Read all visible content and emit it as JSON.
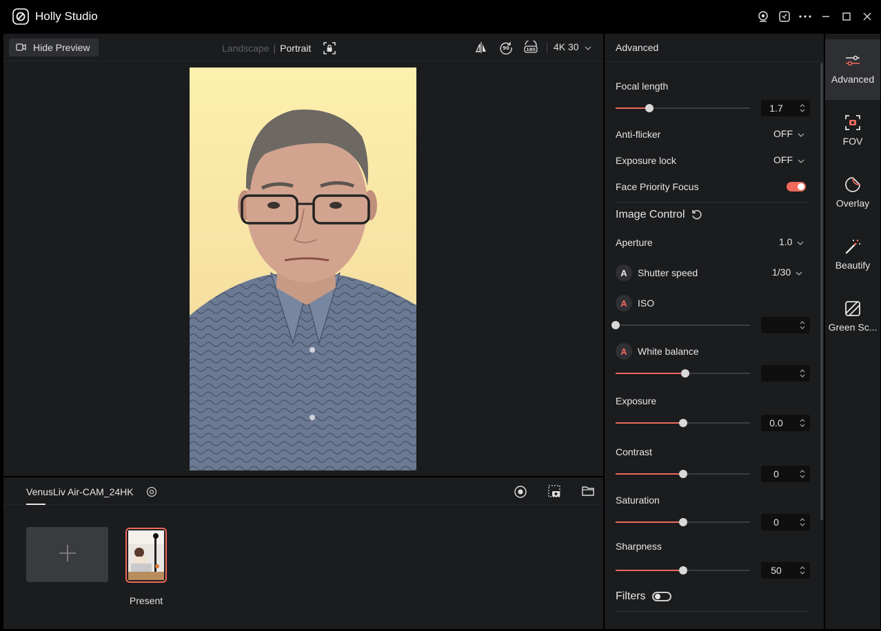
{
  "app": {
    "title": "Holly Studio"
  },
  "preview_toolbar": {
    "hide_preview_label": "Hide Preview",
    "orientation_landscape": "Landscape",
    "orientation_portrait": "Portrait",
    "orientation_selected": "Portrait",
    "resolution": "4K 30"
  },
  "camera": {
    "device_name": "VenusLiv Air-CAM_24HK",
    "scenes": [
      {
        "label": "Present",
        "selected": true
      }
    ]
  },
  "settings": {
    "header": "Advanced",
    "focal_length": {
      "label": "Focal length",
      "value": "1.7",
      "level": 0.25
    },
    "anti_flicker": {
      "label": "Anti-flicker",
      "value": "OFF"
    },
    "exposure_lock": {
      "label": "Exposure lock",
      "value": "OFF"
    },
    "face_priority_focus": {
      "label": "Face Priority Focus",
      "enabled": true
    },
    "image_control": {
      "title": "Image Control",
      "aperture": {
        "label": "Aperture",
        "value": "1.0"
      },
      "shutter_speed": {
        "label": "Shutter speed",
        "value": "1/30",
        "auto_badge": "A",
        "auto": false
      },
      "iso": {
        "label": "ISO",
        "value": "",
        "auto_badge": "A",
        "auto": true,
        "level": 0.0
      },
      "white_balance": {
        "label": "White balance",
        "value": "",
        "auto_badge": "A",
        "auto": true,
        "level": 0.52
      },
      "exposure": {
        "label": "Exposure",
        "value": "0.0",
        "level": 0.5
      },
      "contrast": {
        "label": "Contrast",
        "value": "0",
        "level": 0.5
      },
      "saturation": {
        "label": "Saturation",
        "value": "0",
        "level": 0.5
      },
      "sharpness": {
        "label": "Sharpness",
        "value": "50",
        "level": 0.5
      }
    },
    "filters": {
      "label": "Filters",
      "enabled": false
    }
  },
  "nav": {
    "items": [
      {
        "label": "Advanced",
        "icon": "sliders-icon",
        "active": true
      },
      {
        "label": "FOV",
        "icon": "fov-frame-icon",
        "active": false
      },
      {
        "label": "Overlay",
        "icon": "overlay-sticker-icon",
        "active": false
      },
      {
        "label": "Beautify",
        "icon": "magic-wand-icon",
        "active": false
      },
      {
        "label": "Green Sc...",
        "icon": "green-screen-icon",
        "active": false
      }
    ]
  },
  "colors": {
    "accent": "#ef6a5b",
    "panel": "#1b1c1e",
    "background": "#000000"
  }
}
